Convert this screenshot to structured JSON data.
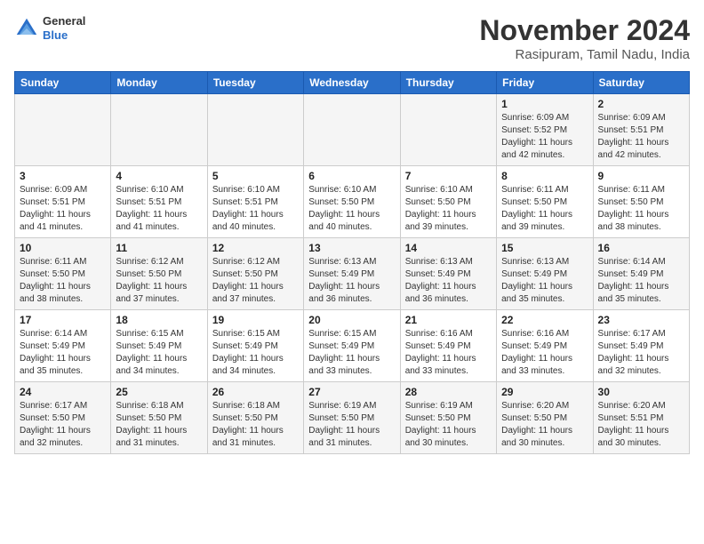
{
  "header": {
    "logo": {
      "general": "General",
      "blue": "Blue"
    },
    "title": "November 2024",
    "subtitle": "Rasipuram, Tamil Nadu, India"
  },
  "weekdays": [
    "Sunday",
    "Monday",
    "Tuesday",
    "Wednesday",
    "Thursday",
    "Friday",
    "Saturday"
  ],
  "weeks": [
    [
      {
        "day": "",
        "info": ""
      },
      {
        "day": "",
        "info": ""
      },
      {
        "day": "",
        "info": ""
      },
      {
        "day": "",
        "info": ""
      },
      {
        "day": "",
        "info": ""
      },
      {
        "day": "1",
        "info": "Sunrise: 6:09 AM\nSunset: 5:52 PM\nDaylight: 11 hours\nand 42 minutes."
      },
      {
        "day": "2",
        "info": "Sunrise: 6:09 AM\nSunset: 5:51 PM\nDaylight: 11 hours\nand 42 minutes."
      }
    ],
    [
      {
        "day": "3",
        "info": "Sunrise: 6:09 AM\nSunset: 5:51 PM\nDaylight: 11 hours\nand 41 minutes."
      },
      {
        "day": "4",
        "info": "Sunrise: 6:10 AM\nSunset: 5:51 PM\nDaylight: 11 hours\nand 41 minutes."
      },
      {
        "day": "5",
        "info": "Sunrise: 6:10 AM\nSunset: 5:51 PM\nDaylight: 11 hours\nand 40 minutes."
      },
      {
        "day": "6",
        "info": "Sunrise: 6:10 AM\nSunset: 5:50 PM\nDaylight: 11 hours\nand 40 minutes."
      },
      {
        "day": "7",
        "info": "Sunrise: 6:10 AM\nSunset: 5:50 PM\nDaylight: 11 hours\nand 39 minutes."
      },
      {
        "day": "8",
        "info": "Sunrise: 6:11 AM\nSunset: 5:50 PM\nDaylight: 11 hours\nand 39 minutes."
      },
      {
        "day": "9",
        "info": "Sunrise: 6:11 AM\nSunset: 5:50 PM\nDaylight: 11 hours\nand 38 minutes."
      }
    ],
    [
      {
        "day": "10",
        "info": "Sunrise: 6:11 AM\nSunset: 5:50 PM\nDaylight: 11 hours\nand 38 minutes."
      },
      {
        "day": "11",
        "info": "Sunrise: 6:12 AM\nSunset: 5:50 PM\nDaylight: 11 hours\nand 37 minutes."
      },
      {
        "day": "12",
        "info": "Sunrise: 6:12 AM\nSunset: 5:50 PM\nDaylight: 11 hours\nand 37 minutes."
      },
      {
        "day": "13",
        "info": "Sunrise: 6:13 AM\nSunset: 5:49 PM\nDaylight: 11 hours\nand 36 minutes."
      },
      {
        "day": "14",
        "info": "Sunrise: 6:13 AM\nSunset: 5:49 PM\nDaylight: 11 hours\nand 36 minutes."
      },
      {
        "day": "15",
        "info": "Sunrise: 6:13 AM\nSunset: 5:49 PM\nDaylight: 11 hours\nand 35 minutes."
      },
      {
        "day": "16",
        "info": "Sunrise: 6:14 AM\nSunset: 5:49 PM\nDaylight: 11 hours\nand 35 minutes."
      }
    ],
    [
      {
        "day": "17",
        "info": "Sunrise: 6:14 AM\nSunset: 5:49 PM\nDaylight: 11 hours\nand 35 minutes."
      },
      {
        "day": "18",
        "info": "Sunrise: 6:15 AM\nSunset: 5:49 PM\nDaylight: 11 hours\nand 34 minutes."
      },
      {
        "day": "19",
        "info": "Sunrise: 6:15 AM\nSunset: 5:49 PM\nDaylight: 11 hours\nand 34 minutes."
      },
      {
        "day": "20",
        "info": "Sunrise: 6:15 AM\nSunset: 5:49 PM\nDaylight: 11 hours\nand 33 minutes."
      },
      {
        "day": "21",
        "info": "Sunrise: 6:16 AM\nSunset: 5:49 PM\nDaylight: 11 hours\nand 33 minutes."
      },
      {
        "day": "22",
        "info": "Sunrise: 6:16 AM\nSunset: 5:49 PM\nDaylight: 11 hours\nand 33 minutes."
      },
      {
        "day": "23",
        "info": "Sunrise: 6:17 AM\nSunset: 5:49 PM\nDaylight: 11 hours\nand 32 minutes."
      }
    ],
    [
      {
        "day": "24",
        "info": "Sunrise: 6:17 AM\nSunset: 5:50 PM\nDaylight: 11 hours\nand 32 minutes."
      },
      {
        "day": "25",
        "info": "Sunrise: 6:18 AM\nSunset: 5:50 PM\nDaylight: 11 hours\nand 31 minutes."
      },
      {
        "day": "26",
        "info": "Sunrise: 6:18 AM\nSunset: 5:50 PM\nDaylight: 11 hours\nand 31 minutes."
      },
      {
        "day": "27",
        "info": "Sunrise: 6:19 AM\nSunset: 5:50 PM\nDaylight: 11 hours\nand 31 minutes."
      },
      {
        "day": "28",
        "info": "Sunrise: 6:19 AM\nSunset: 5:50 PM\nDaylight: 11 hours\nand 30 minutes."
      },
      {
        "day": "29",
        "info": "Sunrise: 6:20 AM\nSunset: 5:50 PM\nDaylight: 11 hours\nand 30 minutes."
      },
      {
        "day": "30",
        "info": "Sunrise: 6:20 AM\nSunset: 5:51 PM\nDaylight: 11 hours\nand 30 minutes."
      }
    ]
  ]
}
